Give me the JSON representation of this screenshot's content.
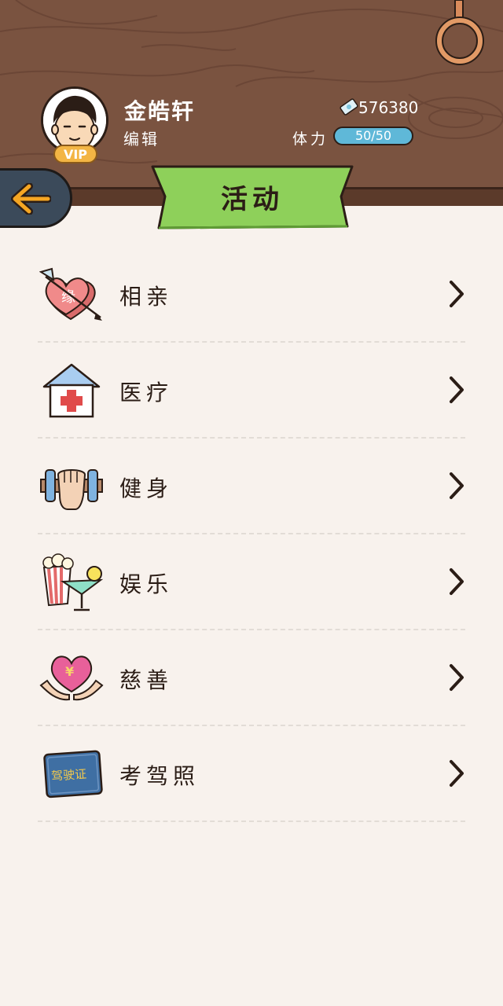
{
  "profile": {
    "name": "金皓轩",
    "role": "编辑",
    "vip": "VIP",
    "money": "576380",
    "stamina_label": "体力",
    "stamina": "50/50"
  },
  "title": "活动",
  "activities": [
    {
      "label": "相亲",
      "icon": "heart-arrow-icon"
    },
    {
      "label": "医疗",
      "icon": "hospital-icon"
    },
    {
      "label": "健身",
      "icon": "dumbbell-icon"
    },
    {
      "label": "娱乐",
      "icon": "popcorn-cocktail-icon"
    },
    {
      "label": "慈善",
      "icon": "charity-heart-icon"
    },
    {
      "label": "考驾照",
      "icon": "driver-license-icon"
    }
  ],
  "colors": {
    "wood": "#7a5340",
    "banner": "#8ed05a",
    "background": "#f8f2ed",
    "stamina": "#5fb8d8"
  }
}
